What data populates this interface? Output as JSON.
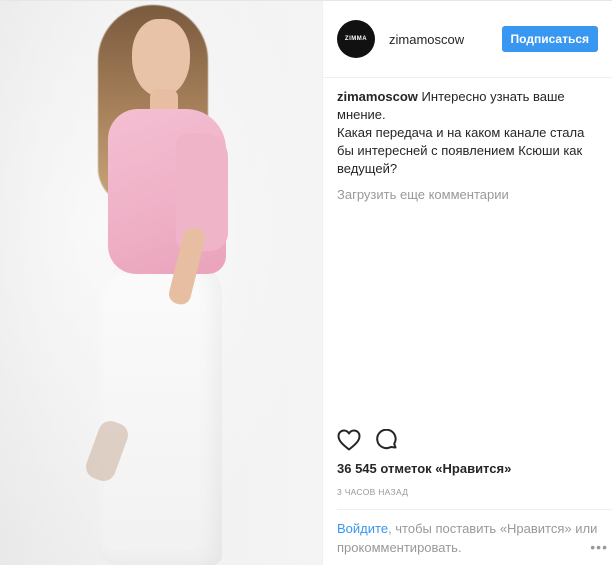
{
  "account": {
    "avatar_text": "ZIMMA",
    "username": "zimamoscow",
    "follow_label": "Подписаться"
  },
  "caption": {
    "username": "zimamoscow",
    "line1": "Интересно узнать ваше мнение.",
    "line2": "Какая передача и на каком канале стала бы интересней с появлением Ксюши как ведущей?"
  },
  "load_more_label": "Загрузить еще комментарии",
  "likes_label": "36 545 отметок «Нравится»",
  "time_label": "3 ЧАСОВ НАЗАД",
  "login": {
    "link_text": "Войдите",
    "rest_text": ", чтобы поставить «Нравится» или прокомментировать."
  },
  "icons": {
    "like": "heart-icon",
    "comment": "comment-bubble-icon",
    "more": "more-options-icon"
  },
  "colors": {
    "accent": "#3897f0",
    "muted": "#999999",
    "text": "#262626"
  }
}
